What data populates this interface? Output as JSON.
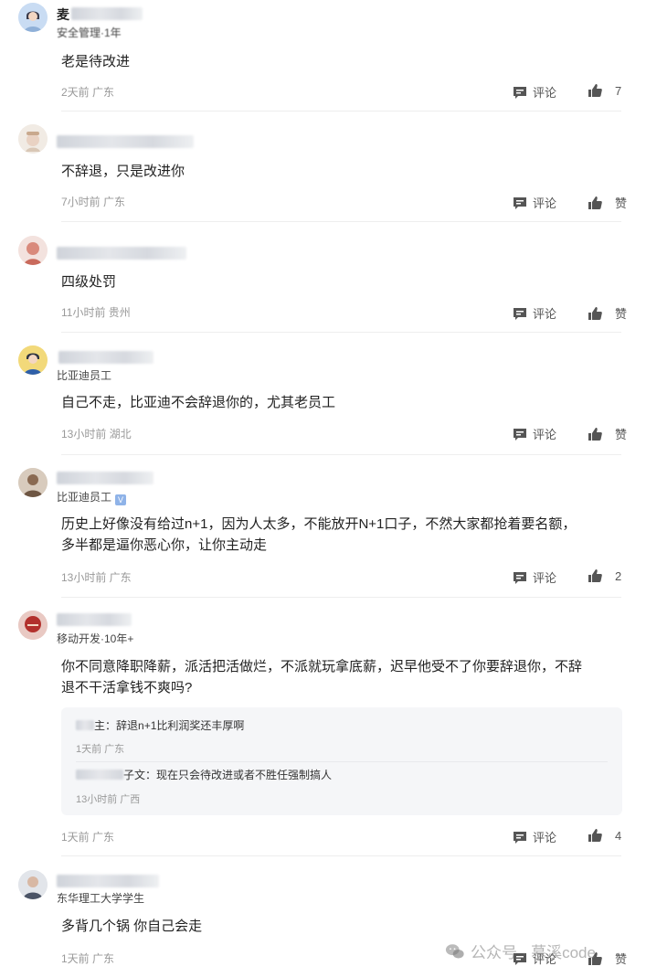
{
  "comments": [
    {
      "user_visible": "麦",
      "sub": "安全管理·1年",
      "text": "老是待改进",
      "meta": "2天前 广东",
      "reply_label": "评论",
      "like_label": "7"
    },
    {
      "sub": "",
      "text": "不辞退，只是改进你",
      "meta": "7小时前 广东",
      "reply_label": "评论",
      "like_label": "赞"
    },
    {
      "sub": "",
      "text": "四级处罚",
      "meta": "11小时前 贵州",
      "reply_label": "评论",
      "like_label": "赞"
    },
    {
      "sub": "比亚迪员工",
      "text": "自己不走，比亚迪不会辞退你的，尤其老员工",
      "meta": "13小时前 湖北",
      "reply_label": "评论",
      "like_label": "赞"
    },
    {
      "sub": "比亚迪员工",
      "verify": "V",
      "text_lines": [
        "历史上好像没有给过n+1，因为人太多，不能放开N+1口子，不然大家都抢着要名额，",
        "多半都是逼你恶心你，让你主动走"
      ],
      "meta": "13小时前 广东",
      "reply_label": "评论",
      "like_label": "2"
    },
    {
      "sub": "移动开发·10年+",
      "text_lines": [
        "你不同意降职降薪，派活把活做烂，不派就玩拿底薪，迟早他受不了你要辞退你，不辞",
        "退不干活拿钱不爽吗?"
      ],
      "replies": [
        {
          "name_suffix": "主：",
          "text": "辞退n+1比利润奖还丰厚啊",
          "meta": "1天前 广东"
        },
        {
          "name_suffix": "子文：",
          "text": "现在只会待改进或者不胜任强制搞人",
          "meta": "13小时前 广西"
        }
      ],
      "meta": "1天前 广东",
      "reply_label": "评论",
      "like_label": "4"
    },
    {
      "sub": "东华理工大学学生",
      "text": "多背几个锅 你自己会走",
      "meta": "1天前 广东",
      "reply_label": "评论",
      "like_label": "赞"
    }
  ],
  "watermark": {
    "text": "公众号 · 慕溪code"
  },
  "colors": {
    "text": "#222222",
    "meta": "#999999",
    "icon": "#555555",
    "reply_bg": "#f5f6f8"
  }
}
